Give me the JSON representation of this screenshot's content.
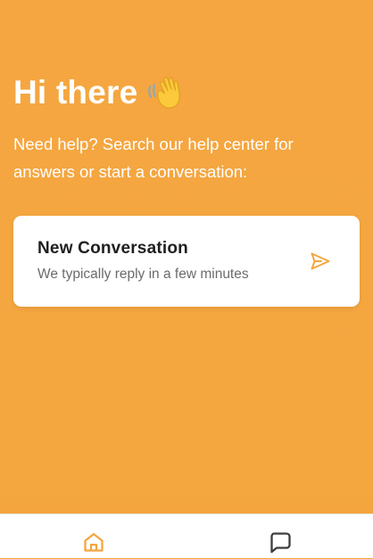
{
  "theme": {
    "accent": "#f5a640",
    "card_bg": "#ffffff",
    "nav_icon_inactive": "#3c3c3c"
  },
  "header": {
    "greeting": "Hi there",
    "greeting_icon": "waving-hand-icon",
    "subtitle": "Need help? Search our help center for answers or start a conversation:"
  },
  "conversation_card": {
    "title": "New Conversation",
    "subtitle": "We typically reply in a few minutes",
    "icon": "send-icon"
  },
  "bottom_nav": {
    "items": [
      {
        "icon": "home-icon",
        "active": true
      },
      {
        "icon": "chat-bubble-icon",
        "active": false
      }
    ]
  }
}
